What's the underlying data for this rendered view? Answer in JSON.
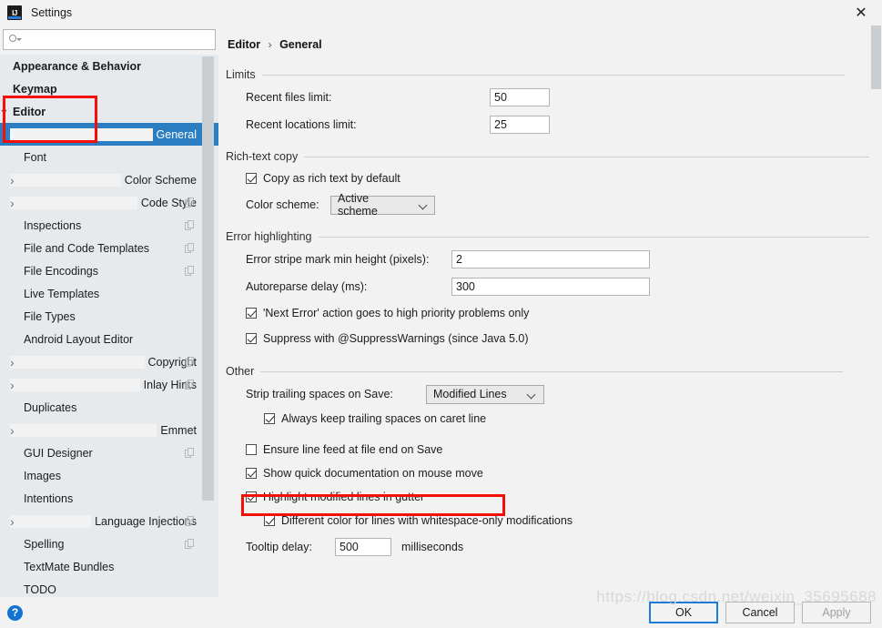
{
  "window": {
    "title": "Settings",
    "app_icon": "IJ",
    "close_label": "✕"
  },
  "search": {
    "value": "",
    "placeholder": ""
  },
  "sidebar": {
    "items": [
      {
        "label": "Appearance & Behavior",
        "level": "root",
        "arrow": "none",
        "bold": true,
        "badge": false,
        "selected": false
      },
      {
        "label": "Keymap",
        "level": "root",
        "arrow": "none",
        "bold": true,
        "badge": false,
        "selected": false
      },
      {
        "label": "Editor",
        "level": "root",
        "arrow": "down",
        "bold": true,
        "badge": false,
        "selected": false
      },
      {
        "label": "General",
        "level": "child",
        "arrow": "right",
        "bold": false,
        "badge": false,
        "selected": true
      },
      {
        "label": "Font",
        "level": "child",
        "arrow": "none",
        "bold": false,
        "badge": false,
        "selected": false
      },
      {
        "label": "Color Scheme",
        "level": "child",
        "arrow": "right",
        "bold": false,
        "badge": false,
        "selected": false
      },
      {
        "label": "Code Style",
        "level": "child",
        "arrow": "right",
        "bold": false,
        "badge": true,
        "selected": false
      },
      {
        "label": "Inspections",
        "level": "child",
        "arrow": "none",
        "bold": false,
        "badge": true,
        "selected": false
      },
      {
        "label": "File and Code Templates",
        "level": "child",
        "arrow": "none",
        "bold": false,
        "badge": true,
        "selected": false
      },
      {
        "label": "File Encodings",
        "level": "child",
        "arrow": "none",
        "bold": false,
        "badge": true,
        "selected": false
      },
      {
        "label": "Live Templates",
        "level": "child",
        "arrow": "none",
        "bold": false,
        "badge": false,
        "selected": false
      },
      {
        "label": "File Types",
        "level": "child",
        "arrow": "none",
        "bold": false,
        "badge": false,
        "selected": false
      },
      {
        "label": "Android Layout Editor",
        "level": "child",
        "arrow": "none",
        "bold": false,
        "badge": false,
        "selected": false
      },
      {
        "label": "Copyright",
        "level": "child",
        "arrow": "right",
        "bold": false,
        "badge": true,
        "selected": false
      },
      {
        "label": "Inlay Hints",
        "level": "child",
        "arrow": "right",
        "bold": false,
        "badge": true,
        "selected": false
      },
      {
        "label": "Duplicates",
        "level": "child",
        "arrow": "none",
        "bold": false,
        "badge": false,
        "selected": false
      },
      {
        "label": "Emmet",
        "level": "child",
        "arrow": "right",
        "bold": false,
        "badge": false,
        "selected": false
      },
      {
        "label": "GUI Designer",
        "level": "child",
        "arrow": "none",
        "bold": false,
        "badge": true,
        "selected": false
      },
      {
        "label": "Images",
        "level": "child",
        "arrow": "none",
        "bold": false,
        "badge": false,
        "selected": false
      },
      {
        "label": "Intentions",
        "level": "child",
        "arrow": "none",
        "bold": false,
        "badge": false,
        "selected": false
      },
      {
        "label": "Language Injections",
        "level": "child",
        "arrow": "right",
        "bold": false,
        "badge": true,
        "selected": false
      },
      {
        "label": "Spelling",
        "level": "child",
        "arrow": "none",
        "bold": false,
        "badge": true,
        "selected": false
      },
      {
        "label": "TextMate Bundles",
        "level": "child",
        "arrow": "none",
        "bold": false,
        "badge": false,
        "selected": false
      },
      {
        "label": "TODO",
        "level": "child",
        "arrow": "none",
        "bold": false,
        "badge": false,
        "selected": false
      }
    ]
  },
  "breadcrumb": {
    "parent": "Editor",
    "separator": "›",
    "current": "General"
  },
  "sections": {
    "limits": {
      "title": "Limits",
      "recent_files": {
        "label": "Recent files limit:",
        "value": "50"
      },
      "recent_locations": {
        "label": "Recent locations limit:",
        "value": "25"
      }
    },
    "rich_text_copy": {
      "title": "Rich-text copy",
      "copy_as_rich_text": {
        "label": "Copy as rich text by default",
        "checked": true
      },
      "color_scheme": {
        "label": "Color scheme:",
        "value": "Active scheme"
      }
    },
    "error_highlighting": {
      "title": "Error highlighting",
      "stripe_min_height": {
        "label": "Error stripe mark min height (pixels):",
        "value": "2"
      },
      "autoreparse_delay": {
        "label": "Autoreparse delay (ms):",
        "value": "300"
      },
      "next_error": {
        "label": "'Next Error' action goes to high priority problems only",
        "checked": true
      },
      "suppress_warnings": {
        "label": "Suppress with @SuppressWarnings (since Java 5.0)",
        "checked": true
      }
    },
    "other": {
      "title": "Other",
      "strip_trailing": {
        "label": "Strip trailing spaces on Save:",
        "value": "Modified Lines"
      },
      "always_keep": {
        "label": "Always keep trailing spaces on caret line",
        "checked": true
      },
      "ensure_line_feed": {
        "label": "Ensure line feed at file end on Save",
        "checked": false
      },
      "show_quick_doc": {
        "label": "Show quick documentation on mouse move",
        "checked": true
      },
      "highlight_modified": {
        "label": "Highlight modified lines in gutter",
        "checked": true
      },
      "different_color": {
        "label": "Different color for lines with whitespace-only modifications",
        "checked": true
      },
      "tooltip_delay": {
        "label": "Tooltip delay:",
        "value": "500",
        "unit": "milliseconds"
      }
    }
  },
  "buttons": {
    "ok": "OK",
    "cancel": "Cancel",
    "apply": "Apply",
    "help": "?"
  },
  "watermark": "https://blog.csdn.net/weixin_35695688",
  "colors": {
    "selection": "#2b7ec1",
    "annotation": "#f60f07",
    "accent": "#1e7bd6",
    "sidebar_bg": "#e6eaed"
  }
}
